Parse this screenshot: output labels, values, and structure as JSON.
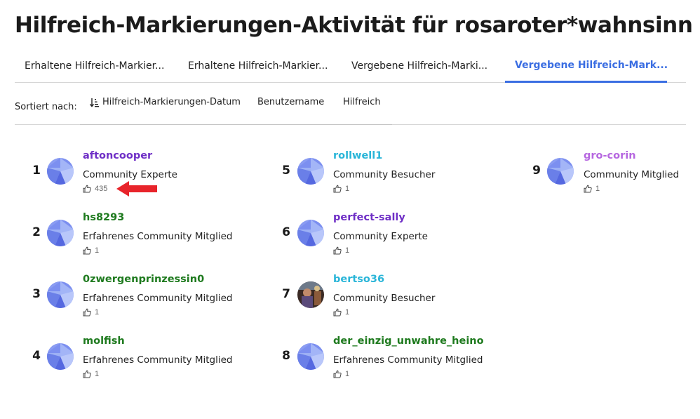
{
  "page": {
    "title": "Hilfreich-Markierungen-Aktivität für rosaroter*wahnsinn"
  },
  "tabs": [
    {
      "label": "Erhaltene Hilfreich-Markier..."
    },
    {
      "label": "Erhaltene Hilfreich-Markier..."
    },
    {
      "label": "Vergebene Hilfreich-Marki..."
    },
    {
      "label": "Vergebene Hilfreich-Mark...",
      "active": true
    }
  ],
  "sort": {
    "label": "Sortiert nach:",
    "options": [
      "Hilfreich-Markierungen-Datum",
      "Benutzername",
      "Hilfreich"
    ]
  },
  "colors": {
    "accent": "#3b6ee2",
    "purple": "#6f2fc6",
    "green": "#1e7a1e",
    "cyan": "#29b5d8",
    "violet": "#b667e0",
    "arrow": "#e8242b"
  },
  "users": [
    {
      "rank": "1",
      "username": "aftoncooper",
      "role": "Community Experte",
      "kudos": "435",
      "color": "#6f2fc6",
      "avatar": "default-avatar-icon"
    },
    {
      "rank": "2",
      "username": "hs8293",
      "role": "Erfahrenes Community Mitglied",
      "kudos": "1",
      "color": "#1e7a1e",
      "avatar": "default-avatar-icon"
    },
    {
      "rank": "3",
      "username": "0zwergenprinzessin0",
      "role": "Erfahrenes Community Mitglied",
      "kudos": "1",
      "color": "#1e7a1e",
      "avatar": "default-avatar-icon"
    },
    {
      "rank": "4",
      "username": "molfish",
      "role": "Erfahrenes Community Mitglied",
      "kudos": "1",
      "color": "#1e7a1e",
      "avatar": "default-avatar-icon"
    },
    {
      "rank": "5",
      "username": "rollwell1",
      "role": "Community Besucher",
      "kudos": "1",
      "color": "#29b5d8",
      "avatar": "default-avatar-icon"
    },
    {
      "rank": "6",
      "username": "perfect-sally",
      "role": "Community Experte",
      "kudos": "1",
      "color": "#6f2fc6",
      "avatar": "default-avatar-icon"
    },
    {
      "rank": "7",
      "username": "bertso36",
      "role": "Community Besucher",
      "kudos": "1",
      "color": "#29b5d8",
      "avatar": "photo-avatar"
    },
    {
      "rank": "8",
      "username": "der_einzig_unwahre_heino",
      "role": "Erfahrenes Community Mitglied",
      "kudos": "1",
      "color": "#1e7a1e",
      "avatar": "default-avatar-icon"
    },
    {
      "rank": "9",
      "username": "gro-corin",
      "role": "Community Mitglied",
      "kudos": "1",
      "color": "#b667e0",
      "avatar": "default-avatar-icon"
    }
  ]
}
